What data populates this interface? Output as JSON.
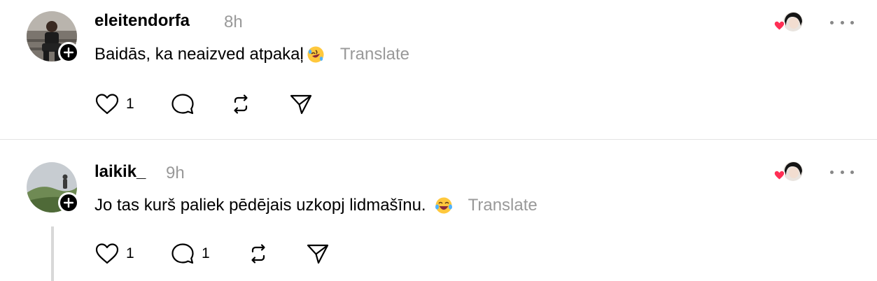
{
  "posts": [
    {
      "username": "eleitendorfa",
      "time": "8h",
      "text": "Baidās, ka neaizved atpakaļ",
      "emoji_icon": "rolling-on-floor-laughing-emoji",
      "translate_label": "Translate",
      "like_count": "1",
      "reply_count": ""
    },
    {
      "username": "laikik_",
      "time": "9h",
      "text": "Jo tas kurš paliek pēdējais uzkopj lidmašīnu.",
      "emoji_icon": "tears-of-joy-emoji",
      "translate_label": "Translate",
      "like_count": "1",
      "reply_count": "1"
    }
  ],
  "colors": {
    "muted": "#999999",
    "like_red": "#ff2f55",
    "divider": "#e4e4e4"
  }
}
